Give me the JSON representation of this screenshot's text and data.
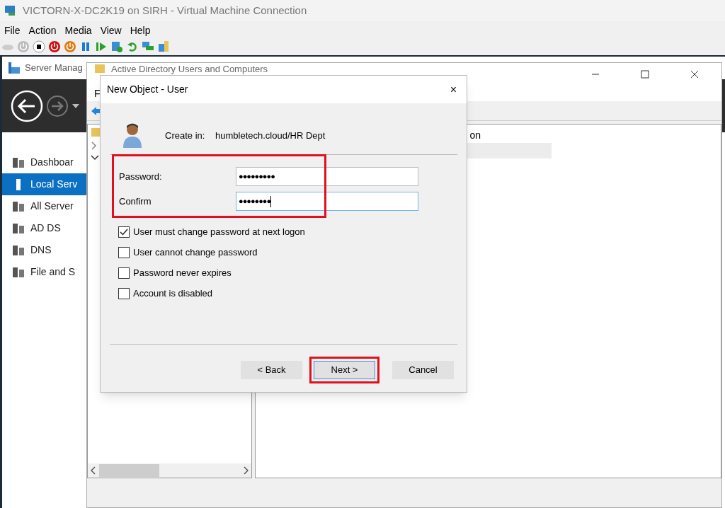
{
  "vm_window": {
    "title": "VICTORN-X-DC2K19 on SIRH - Virtual Machine Connection",
    "menu": [
      "File",
      "Action",
      "Media",
      "View",
      "Help"
    ]
  },
  "server_manager": {
    "title": "Server Manag",
    "sidebar": [
      {
        "label": "Dashboar",
        "selected": false
      },
      {
        "label": "Local Serv",
        "selected": true
      },
      {
        "label": "All Server",
        "selected": false
      },
      {
        "label": "AD DS",
        "selected": false
      },
      {
        "label": "DNS",
        "selected": false
      },
      {
        "label": "File and S",
        "selected": false
      }
    ]
  },
  "aduc": {
    "title": "Active Directory Users and Computers",
    "menu": [
      "F"
    ],
    "list_rows": [
      {
        "label": "on",
        "selected": false
      },
      {
        "selected": true
      }
    ]
  },
  "dialog": {
    "title": "New Object - User",
    "close": "×",
    "create_in_label": "Create in:",
    "create_in_value": "humbletech.cloud/HR Dept",
    "fields_highlighted": true,
    "fields": [
      {
        "label": "Password:",
        "value": "●●●●●●●●●",
        "focused": false
      },
      {
        "label": "Confirm",
        "value": "●●●●●●●●",
        "focused": true
      }
    ],
    "options": [
      {
        "label": "User must change password at next logon",
        "checked": true
      },
      {
        "label": "User cannot change password",
        "checked": false
      },
      {
        "label": "Password never expires",
        "checked": false
      },
      {
        "label": "Account is disabled",
        "checked": false
      }
    ],
    "buttons": [
      {
        "label": "< Back",
        "default": false,
        "highlighted": false
      },
      {
        "label": "Next >",
        "default": true,
        "highlighted": true
      },
      {
        "label": "Cancel",
        "default": false,
        "highlighted": false
      }
    ]
  }
}
